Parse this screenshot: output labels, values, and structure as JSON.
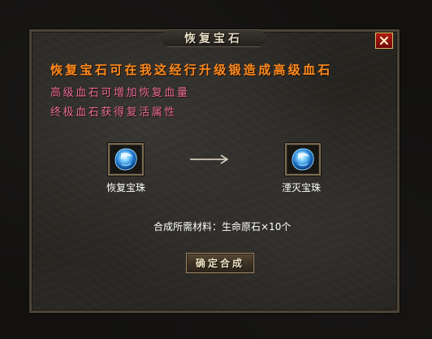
{
  "window": {
    "title": "恢复宝石",
    "close_icon": "close-icon"
  },
  "description": {
    "line1": "恢复宝石可在我这经行升级锻造成高级血石",
    "line2": "高级血石可增加恢复血量",
    "line3": "终极血石获得复活属性",
    "colors": {
      "line1": "#ff8a1e",
      "other_lines": "#e86e96"
    }
  },
  "upgrade": {
    "source_item": {
      "name": "恢复宝珠",
      "icon": "blue-gem-icon"
    },
    "arrow_icon": "right-arrow-icon",
    "target_item": {
      "name": "湮灭宝珠",
      "icon": "blue-gem-icon"
    }
  },
  "materials_text": "合成所需材料：生命原石×10个",
  "confirm_button_label": "确定合成"
}
